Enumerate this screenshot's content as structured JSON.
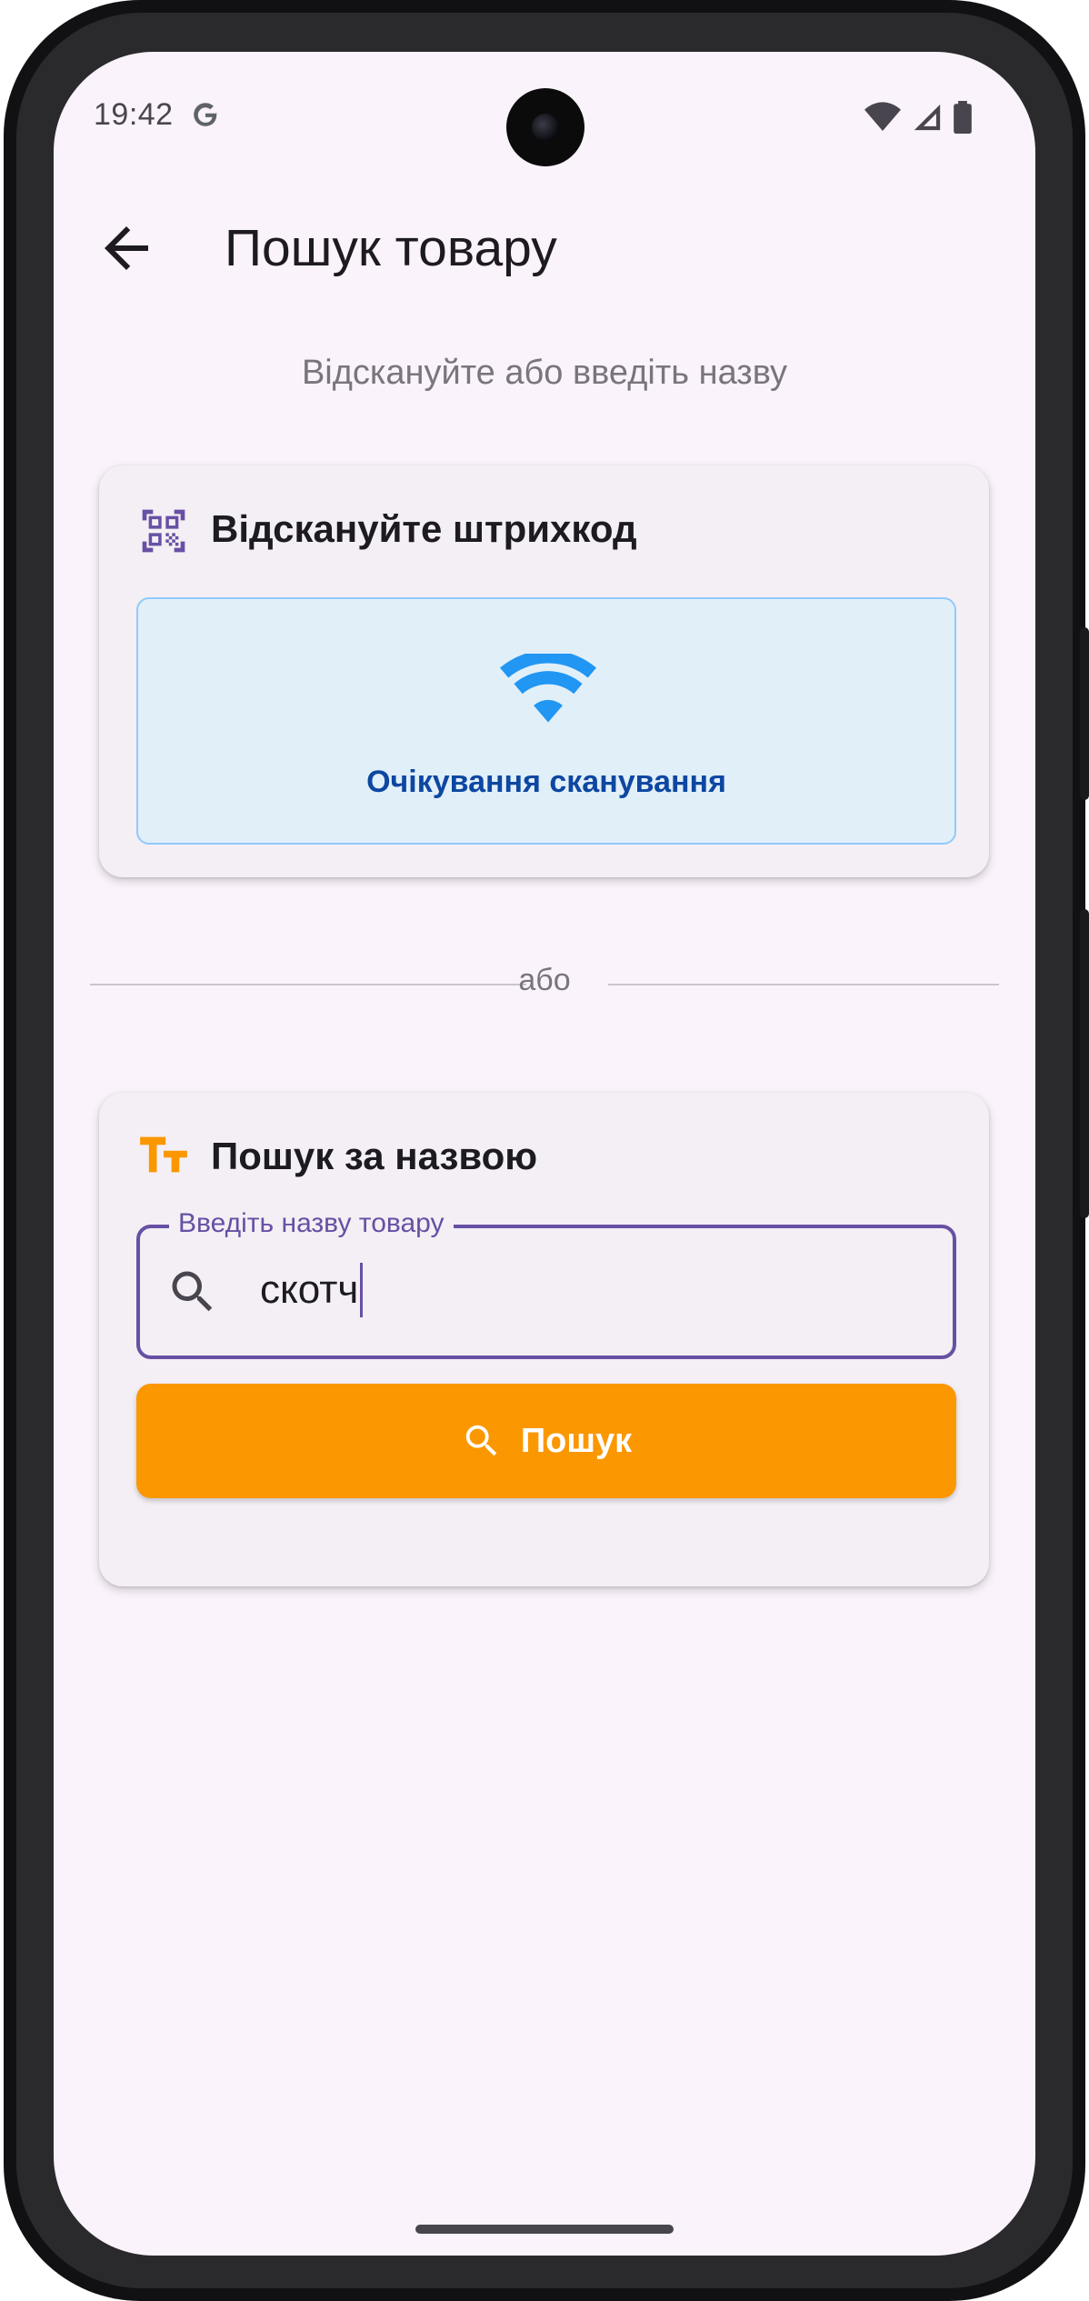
{
  "status_bar": {
    "time": "19:42",
    "icons": [
      "google-g-icon",
      "wifi-icon",
      "cellular-signal-icon",
      "battery-icon"
    ]
  },
  "app_bar": {
    "back_icon": "arrow-back-icon",
    "title": "Пошук товару"
  },
  "subtitle": "Відскануйте або введіть назву",
  "scan_card": {
    "icon": "qr-code-scanner-icon",
    "title": "Відскануйте штрихкод",
    "status_icon": "wifi-icon",
    "status_text": "Очікування сканування"
  },
  "divider_text": "або",
  "name_card": {
    "icon": "text-fields-icon",
    "title": "Пошук за назвою",
    "input_label": "Введіть назву товару",
    "input_value": "скотч",
    "input_icon": "search-icon",
    "button_icon": "search-icon",
    "button_label": "Пошук"
  },
  "colors": {
    "background": "#fbf3fb",
    "accent": "#6750a4",
    "button": "#fb9700",
    "scan_box": "#e1eff9",
    "scan_text": "#0d47a1",
    "scan_icon": "#2196f3"
  }
}
